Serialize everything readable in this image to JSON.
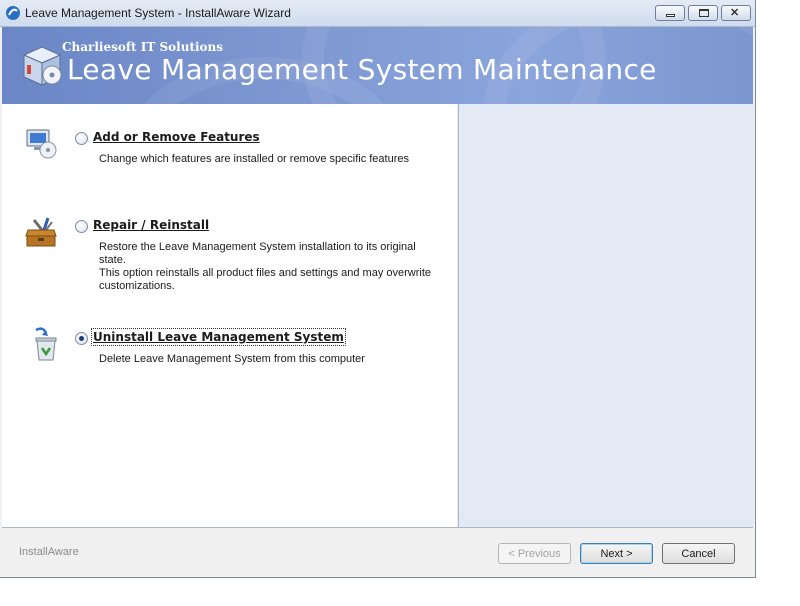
{
  "window": {
    "title": "Leave Management System - InstallAware Wizard"
  },
  "banner": {
    "company": "Charliesoft IT Solutions",
    "title": "Leave Management System Maintenance"
  },
  "options": [
    {
      "label": "Add or Remove Features",
      "description": "Change which features are installed or remove specific features",
      "selected": false,
      "icon": "computer-cd-icon"
    },
    {
      "label": "Repair / Reinstall",
      "description_lines": [
        "Restore the Leave Management System installation to its original state.",
        "This option reinstalls all product files and settings and may overwrite",
        "customizations."
      ],
      "selected": false,
      "icon": "toolbox-icon"
    },
    {
      "label": "Uninstall Leave Management System",
      "description": "Delete Leave Management System from this computer",
      "selected": true,
      "icon": "recycle-bin-icon"
    }
  ],
  "footer": {
    "brand": "InstallAware",
    "previous_label": "< Previous",
    "next_label": "Next >",
    "cancel_label": "Cancel"
  },
  "colors": {
    "banner": "#7e98d2",
    "side_panel": "#e3eaf6"
  }
}
